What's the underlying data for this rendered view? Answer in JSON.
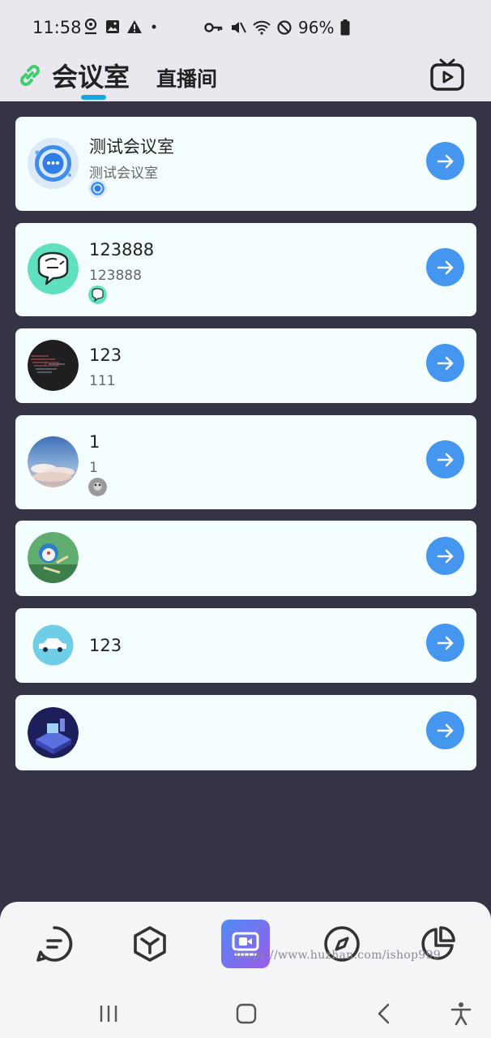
{
  "status_bar": {
    "time": "11:58",
    "battery": "96%"
  },
  "header": {
    "tabs": [
      {
        "label": "会议室",
        "active": true
      },
      {
        "label": "直播间",
        "active": false
      }
    ],
    "accent": "#19a6e2"
  },
  "rooms": [
    {
      "name": "测试会议室",
      "desc": "测试会议室",
      "avatar_icon": "chat-bubble-icon",
      "has_member": true
    },
    {
      "name": "123888",
      "desc": "123888",
      "avatar_icon": "doodle-chat-icon",
      "has_member": true
    },
    {
      "name": "123",
      "desc": "111",
      "avatar_icon": "terminal-screenshot-icon",
      "has_member": false
    },
    {
      "name": "1",
      "desc": "1",
      "avatar_icon": "sky-clouds-icon",
      "has_member": true
    },
    {
      "name": "",
      "desc": "",
      "avatar_icon": "cartoon-character-icon",
      "has_member": false
    },
    {
      "name": "123",
      "desc": "",
      "avatar_icon": "car-icon",
      "has_member": false
    },
    {
      "name": "",
      "desc": "",
      "avatar_icon": "isometric-office-icon",
      "has_member": false
    }
  ],
  "bottom_nav": {
    "items": [
      {
        "icon": "message-icon",
        "active": false
      },
      {
        "icon": "cube-icon",
        "active": false
      },
      {
        "icon": "video-conference-icon",
        "active": true
      },
      {
        "icon": "compass-icon",
        "active": false
      },
      {
        "icon": "pie-chart-icon",
        "active": false
      }
    ],
    "watermark": "https://www.huzhan.com/ishop999"
  },
  "colors": {
    "background": "#343445",
    "card": "#f5feff",
    "enter_button": "#4596ef"
  }
}
